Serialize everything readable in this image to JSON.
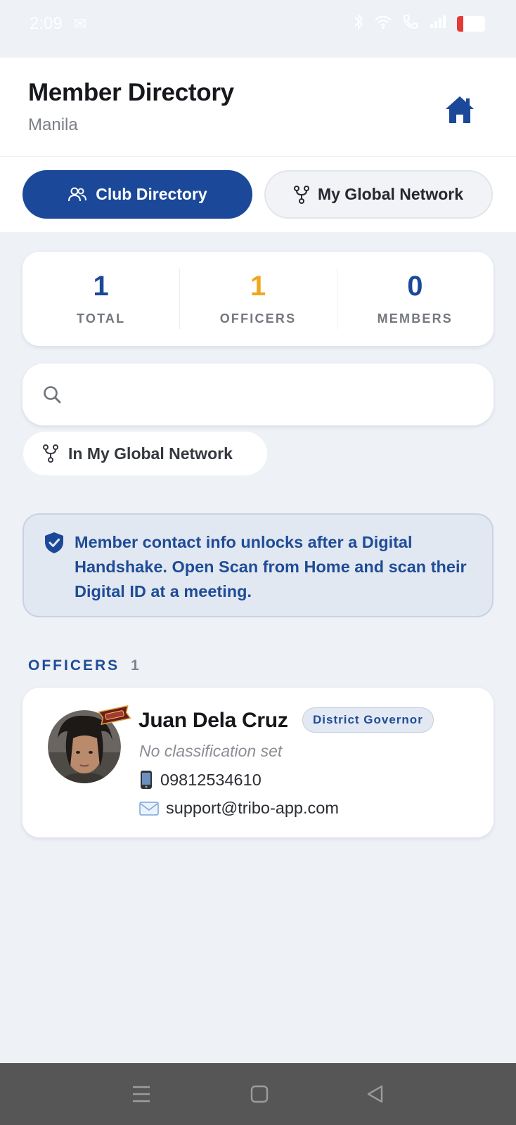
{
  "status_bar": {
    "time": "2:09",
    "icons": [
      "message-icon",
      "bluetooth-icon",
      "wifi-icon",
      "call-icon",
      "signal-icon",
      "battery-icon"
    ],
    "battery_color": "#e53935"
  },
  "header": {
    "title": "Member Directory",
    "subtitle": "Manila",
    "home_icon": "home-icon"
  },
  "tabs": [
    {
      "label": "Club Directory",
      "icon": "people-icon",
      "active": true
    },
    {
      "label": "My Global Network",
      "icon": "network-icon",
      "active": false
    }
  ],
  "stats": [
    {
      "value": "1",
      "label": "TOTAL",
      "color": "#1b4899"
    },
    {
      "value": "1",
      "label": "OFFICERS",
      "color": "#f0a71c"
    },
    {
      "value": "0",
      "label": "MEMBERS",
      "color": "#1b4899"
    }
  ],
  "search": {
    "value": "",
    "placeholder": "",
    "icon": "search-icon"
  },
  "filter_chip": {
    "label": "In My Global Network",
    "icon": "network-icon"
  },
  "info_banner": {
    "icon": "shield-check-icon",
    "text": "Member contact info unlocks after a Digital Handshake. Open Scan from Home and scan their Digital ID at a meeting."
  },
  "officers_section": {
    "title": "OFFICERS",
    "count": "1",
    "members": [
      {
        "name": "Juan Dela Cruz",
        "role": "District Governor",
        "classification": "No classification set",
        "phone": "09812534610",
        "email": "support@tribo-app.com",
        "phone_icon": "mobile-phone-icon",
        "email_icon": "envelope-icon"
      }
    ]
  },
  "colors": {
    "primary": "#1b4899",
    "accent": "#f0a71c",
    "background": "#eef1f6",
    "banner_text": "#1f4c97"
  },
  "nav_bar": {
    "buttons": [
      "menu-icon",
      "home-square-icon",
      "back-triangle-icon"
    ]
  }
}
